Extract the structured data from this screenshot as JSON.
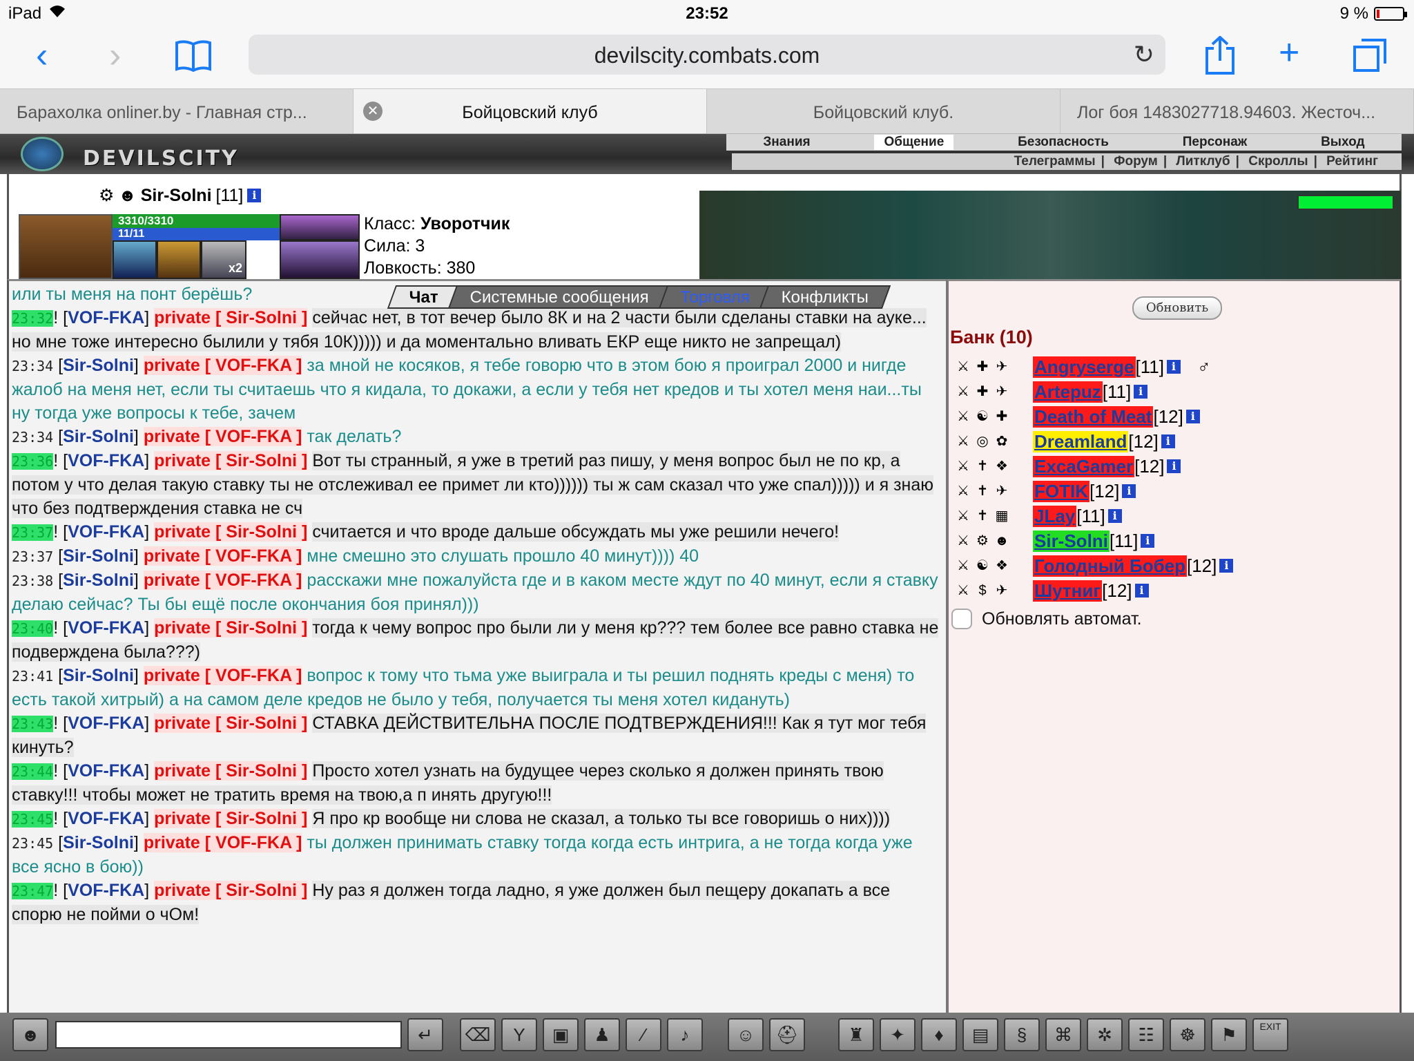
{
  "status": {
    "device": "iPad",
    "time": "23:52",
    "battery": "9 %"
  },
  "browser": {
    "url": "devilscity.combats.com",
    "tabs": [
      {
        "title": "Барахолка onliner.by - Главная стр..."
      },
      {
        "title": "Бойцовский клуб"
      },
      {
        "title": "Бойцовский клуб."
      },
      {
        "title": "Лог боя 1483027718.94603. Жесточ..."
      }
    ]
  },
  "game": {
    "logo": "DEVILSCITY",
    "menu": [
      "Знания",
      "Общение",
      "Безопасность",
      "Персонаж",
      "Выход"
    ],
    "submenu": [
      "Телеграммы",
      "Форум",
      "Литклуб",
      "Скроллы",
      "Рейтинг"
    ],
    "submenu_sep": "|",
    "character": {
      "name": "Sir-Solni",
      "level": "[11]",
      "hp": "3310/3310",
      "mp": "11/11",
      "slot_badge": "x2",
      "class_label": "Класс:",
      "class_value": "Уворотчик",
      "strength": "Сила: 3",
      "agility": "Ловкость: 380"
    }
  },
  "chat": {
    "tabs": [
      "Чат",
      "Системные сообщения",
      "Торговля",
      "Конфликты"
    ],
    "prefix": "или ты меня на понт берёшь?",
    "messages": [
      {
        "time": "23:32",
        "dir": "in",
        "from": "VOF-FKA",
        "to": "private [ Sir-Solni ]",
        "text": "сейчас нет, в тот вечер было 8К и на 2 части были сделаны ставки на ауке... но мне тоже интересно былили у тябя 10К))))) и да моментально вливать ЕКР еще никто не запрещал)"
      },
      {
        "time": "23:34",
        "dir": "out",
        "from": "Sir-Solni",
        "to": "private [ VOF-FKA ]",
        "text": "за мной не косяков, я тебе говорю что в этом бою я проиграл 2000 и нигде жалоб на меня нет, если ты считаешь что я кидала, то докажи, а если у тебя нет кредов и ты хотел меня наи...ты ну тогда уже вопросы к тебе, зачем"
      },
      {
        "time": "23:34",
        "dir": "out",
        "from": "Sir-Solni",
        "to": "private [ VOF-FKA ]",
        "text": "так делать?"
      },
      {
        "time": "23:36",
        "dir": "in",
        "from": "VOF-FKA",
        "to": "private [ Sir-Solni ]",
        "text": "Вот ты странный, я уже в третий раз пишу, у меня вопрос был не по кр, а потом у что делая такую ставку ты не отслеживал ее примет ли кто)))))) ты ж сам сказал что уже спал))))) и я знаю что без подтверждения ставка не сч"
      },
      {
        "time": "23:37",
        "dir": "in",
        "from": "VOF-FKA",
        "to": "private [ Sir-Solni ]",
        "text": "считается и что вроде дальше обсуждать мы уже решили нечего!"
      },
      {
        "time": "23:37",
        "dir": "out",
        "from": "Sir-Solni",
        "to": "private [ VOF-FKA ]",
        "text": "мне смешно это слушать прошло 40 минут)))) 40"
      },
      {
        "time": "23:38",
        "dir": "out",
        "from": "Sir-Solni",
        "to": "private [ VOF-FKA ]",
        "text": "расскажи мне пожалуйста где и в каком месте ждут по 40 минут, если я ставку делаю сейчас? Ты бы ещё после окончания боя принял)))"
      },
      {
        "time": "23:40",
        "dir": "in",
        "from": "VOF-FKA",
        "to": "private [ Sir-Solni ]",
        "text": "тогда к чему вопрос про были ли у меня кр??? тем более все равно ставка не подверждена была???)"
      },
      {
        "time": "23:41",
        "dir": "out",
        "from": "Sir-Solni",
        "to": "private [ VOF-FKA ]",
        "text": "вопрос к тому что тьма уже выиграла и ты решил поднять креды с меня) то есть такой хитрый) а на самом деле кредов не было у тебя, получается ты меня хотел кидануть)"
      },
      {
        "time": "23:43",
        "dir": "in",
        "from": "VOF-FKA",
        "to": "private [ Sir-Solni ]",
        "text": "СТАВКА ДЕЙСТВИТЕЛЬНА ПОСЛЕ ПОДТВЕРЖДЕНИЯ!!! Как я тут мог тебя кинуть?"
      },
      {
        "time": "23:44",
        "dir": "in",
        "from": "VOF-FKA",
        "to": "private [ Sir-Solni ]",
        "text": "Просто хотел узнать на будущее через сколько я должен принять твою ставку!!! чтобы может не тратить время на твою,а п инять другую!!!"
      },
      {
        "time": "23:45",
        "dir": "in",
        "from": "VOF-FKA",
        "to": "private [ Sir-Solni ]",
        "text": "Я про кр вообще ни слова не сказал, а только ты все говоришь о них))))"
      },
      {
        "time": "23:45",
        "dir": "out",
        "from": "Sir-Solni",
        "to": "private [ VOF-FKA ]",
        "text": "ты должен принимать ставку тогда когда есть интрига, а не тогда когда уже все ясно в бою))"
      },
      {
        "time": "23:47",
        "dir": "in",
        "from": "VOF-FKA",
        "to": "private [ Sir-Solni ]",
        "text": "Ну раз я должен тогда ладно, я уже должен был пещеру докапать а все спорю не пойми о чОм!"
      }
    ]
  },
  "room": {
    "refresh_label": "Обновить",
    "title": "Банк (10)",
    "auto_label": "Обновлять автомат.",
    "users": [
      {
        "nick": "Angryserge",
        "level": "[11]",
        "hl": "red"
      },
      {
        "nick": "Artepuz",
        "level": "[11]",
        "hl": "red"
      },
      {
        "nick": "Death of Meat",
        "level": "[12]",
        "hl": "red"
      },
      {
        "nick": "Dreamland",
        "level": "[12]",
        "hl": "yel"
      },
      {
        "nick": "ExcaGamer",
        "level": "[12]",
        "hl": "red"
      },
      {
        "nick": "FOTIK",
        "level": "[12]",
        "hl": "red"
      },
      {
        "nick": "JLay",
        "level": "[11]",
        "hl": "red"
      },
      {
        "nick": "Sir-Solni",
        "level": "[11]",
        "hl": "grn"
      },
      {
        "nick": "Голодный Бобер",
        "level": "[12]",
        "hl": "red"
      },
      {
        "nick": "Шутниг",
        "level": "[12]",
        "hl": "red"
      }
    ]
  },
  "bottombar": {
    "exit_label": "EXIT"
  }
}
